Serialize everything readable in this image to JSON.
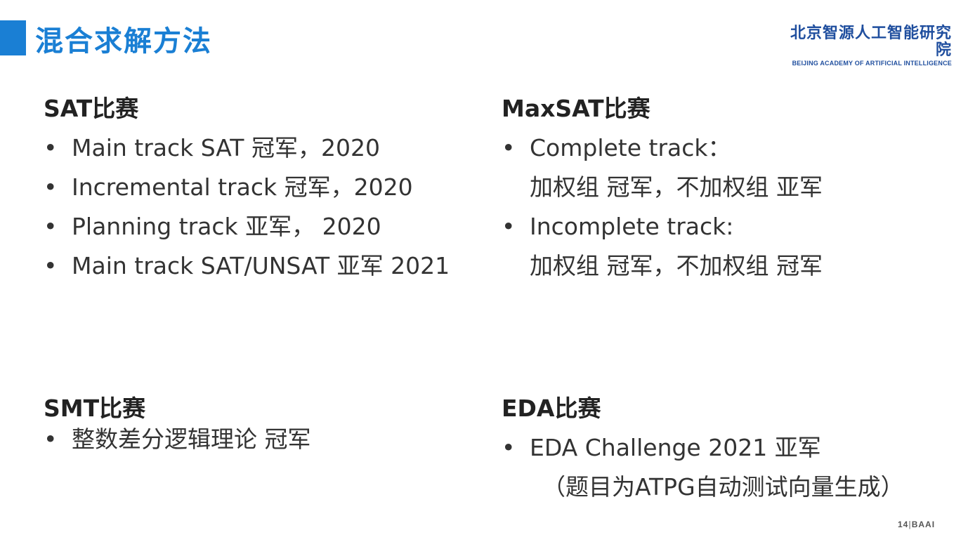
{
  "header": {
    "title": "混合求解方法",
    "logo_cn": "北京智源人工智能研究院",
    "logo_en": "BEIJING ACADEMY OF ARTIFICIAL INTELLIGENCE"
  },
  "sat": {
    "heading": "SAT比赛",
    "items": [
      "Main track SAT 冠军，2020",
      "Incremental track 冠军，2020",
      "Planning track 亚军， 2020",
      "Main track SAT/UNSAT 亚军 2021"
    ]
  },
  "maxsat": {
    "heading": "MaxSAT比赛",
    "items": [
      {
        "line1": "Complete track：",
        "line2": "加权组 冠军，不加权组 亚军"
      },
      {
        "line1": "Incomplete track:",
        "line2": "加权组 冠军，不加权组 冠军"
      }
    ]
  },
  "smt": {
    "heading": "SMT比赛",
    "items": [
      "整数差分逻辑理论  冠军"
    ]
  },
  "eda": {
    "heading": "EDA比赛",
    "items": [
      "EDA Challenge 2021 亚军"
    ],
    "note": "（题目为ATPG自动测试向量生成）"
  },
  "footer": {
    "page_number": "14",
    "brand": "BAAI"
  },
  "colors": {
    "accent": "#1a7fd4",
    "logo": "#1f4e9e",
    "text": "#333333"
  }
}
